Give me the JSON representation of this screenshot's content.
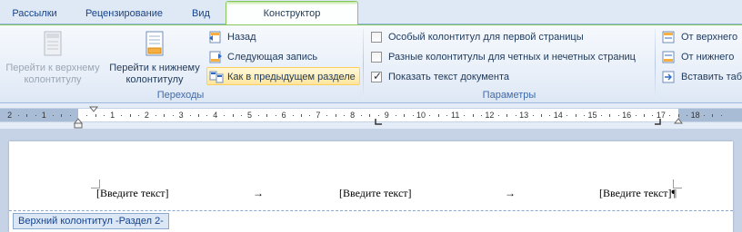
{
  "tabs": [
    "Рассылки",
    "Рецензирование",
    "Вид",
    "Конструктор"
  ],
  "groups": {
    "navigation": {
      "label": "Переходы",
      "go_to_header": "Перейти к верхнему колонтитулу",
      "go_to_footer": "Перейти к нижнему колонтитулу",
      "previous": "Назад",
      "next": "Следующая запись",
      "link_to_previous": "Как в предыдущем разделе"
    },
    "options": {
      "label": "Параметры",
      "different_first_page": "Особый колонтитул для первой страницы",
      "different_odd_even": "Разные колонтитулы для четных и нечетных страниц",
      "show_document_text": "Показать текст документа",
      "different_first_page_checked": false,
      "different_odd_even_checked": false,
      "show_document_text_checked": true
    },
    "position": {
      "header_from_top": "От верхнего",
      "footer_from_bottom": "От нижнего",
      "insert_alignment_tab": "Вставить табу"
    }
  },
  "ruler": {
    "numbers": [
      "2",
      "1",
      "1",
      "2",
      "3",
      "4",
      "5",
      "6",
      "7",
      "8",
      "9",
      "10",
      "11",
      "12",
      "13",
      "14",
      "15",
      "16",
      "17",
      "18"
    ]
  },
  "document": {
    "header_left": "[Введите текст]",
    "header_center": "[Введите текст]",
    "header_right": "[Введите текст]¶",
    "tab_arrow": "→",
    "header_tag": "Верхний колонтитул -Раздел 2-"
  },
  "colors": {
    "accent_green": "#85c75b",
    "ribbon_text": "#1e395b",
    "group_label": "#3e6aaa",
    "highlight": "#ffe69e"
  }
}
